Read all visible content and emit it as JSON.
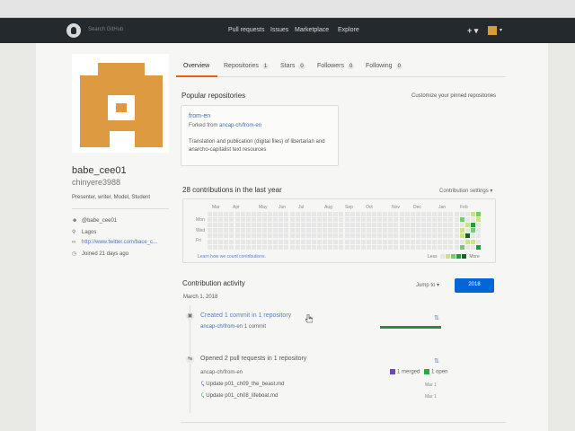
{
  "header": {
    "search_placeholder": "Search GitHub",
    "nav": [
      "Pull requests",
      "Issues",
      "Marketplace",
      "Explore"
    ],
    "plus": "+ ▾",
    "avatar_caret": "▾"
  },
  "profile": {
    "fullname": "babe_cee01",
    "username": "chinyere3988",
    "bio": "Presenter, writer, Model, Student",
    "org": "@babe_cee01",
    "location": "Lagos",
    "url": "http://www.twitter.com/bace_c...",
    "joined": "Joined 21 days ago"
  },
  "tabs": [
    {
      "label": "Overview",
      "count": ""
    },
    {
      "label": "Repositories",
      "count": "1"
    },
    {
      "label": "Stars",
      "count": "0"
    },
    {
      "label": "Followers",
      "count": "0"
    },
    {
      "label": "Following",
      "count": "0"
    }
  ],
  "popular": {
    "title": "Popular repositories",
    "customize": "Customize your pinned repositories",
    "repo_name": "from-en",
    "forked_prefix": "Forked from",
    "forked_repo": "ancap-ch/from-en",
    "desc": "Translation and publication (digital files) of libertarian and anarcho-capitalist text resources"
  },
  "contributions": {
    "title": "28 contributions in the last year",
    "settings": "Contribution settings ▾",
    "months": [
      "Mar",
      "Apr",
      "May",
      "Jun",
      "Jul",
      "Aug",
      "Sep",
      "Oct",
      "Nov",
      "Dec",
      "Jan",
      "Feb"
    ],
    "days": [
      "Mon",
      "Wed",
      "Fri"
    ],
    "footer_link": "Learn how we count contributions.",
    "less": "Less",
    "more": "More",
    "colors": [
      "#e6e7e6",
      "#c6e48b",
      "#7bc96f",
      "#239a3b",
      "#196127"
    ]
  },
  "activity": {
    "title": "Contribution activity",
    "jump": "Jump to ▾",
    "year": "2018",
    "date": "March 1, 2018",
    "item1_title": "Created 1 commit in 1 repository",
    "item1_repo": "ancap-ch/from-en",
    "item1_commits": "1 commit",
    "item2_title": "Opened 2 pull requests in 1 repository",
    "item2_repo": "ancap-ch/from-en",
    "item2_merged": "1 merged",
    "item2_open": "1 open",
    "pr1": "Update p01_ch09_the_beast.md",
    "pr1_date": "Mar 1",
    "pr2": "Update p01_ch08_lifeboat.md",
    "pr2_date": "Mar 1"
  }
}
